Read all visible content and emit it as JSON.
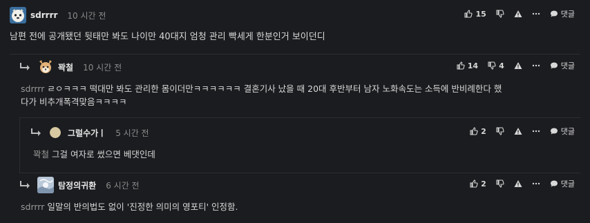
{
  "comments": [
    {
      "author": "sdrrrr",
      "time": "10 시간 전",
      "text": "남편 전에 공개됐던 뒷태만 봐도 나이만 40대지 엄청 관리 빡세게 한분인거 보이던디",
      "mention": "",
      "likes": "15",
      "dislikes": "",
      "reply_label": "댓글"
    },
    {
      "author": "꽉철",
      "time": "10 시간 전",
      "mention": "sdrrrr",
      "text_line1": " ㄹㅇㅋㅋㅋ 떡대만 봐도 관리한 몸이더만ㅋㅋㅋㅋㅋㅋ 결혼기사 났을 때 20대 후반부터 남자 노화속도는 소득에 반비례한다 했",
      "text_line2": "다가 비추개폭격맞음ㅋㅋㅋㅋ",
      "likes": "14",
      "dislikes": "4",
      "reply_label": "댓글"
    },
    {
      "author": "그럴수가ㅣ",
      "time": "5 시간 전",
      "mention": "꽉철",
      "text": " 그걸 여자로 썼으면 베댓인데",
      "likes": "2",
      "dislikes": "",
      "reply_label": "댓글"
    },
    {
      "author": "탐정의귀환",
      "time": "6 시간 전",
      "mention": "sdrrrr",
      "text": " 일말의 반의법도 없이 '진정한 의미의 영포티' 인정함.",
      "likes": "2",
      "dislikes": "",
      "reply_label": "댓글"
    }
  ]
}
